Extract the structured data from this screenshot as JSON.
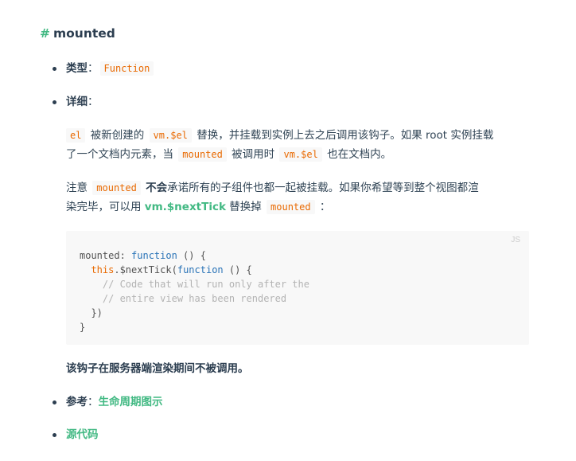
{
  "heading": {
    "hash": "#",
    "title": "mounted"
  },
  "type_item": {
    "label": "类型",
    "colon": "：",
    "value": "Function"
  },
  "detail_item": {
    "label": "详细",
    "colon": "："
  },
  "para1": {
    "code1": "el",
    "text1": "被新创建的",
    "code2": "vm.$el",
    "text2": "替换，并挂载到实例上去之后调用该钩子。如果 root 实例挂载",
    "text3": "了一个文档内元素，当",
    "code3": "mounted",
    "text4": "被调用时",
    "code4": "vm.$el",
    "text5": "也在文档内。"
  },
  "para2": {
    "text1": "注意",
    "code1": "mounted",
    "bold1": "不会",
    "text2": "承诺所有的子组件也都一起被挂载。如果你希望等到整个视图都渲",
    "text3": "染完毕，可以用",
    "link1": "vm.$nextTick",
    "text4": "替换掉",
    "code2": "mounted",
    "text5": "："
  },
  "codeblock": {
    "lang": "JS",
    "l1a": "mounted: ",
    "l1kw": "function",
    "l1b": " () {",
    "l2a": "  ",
    "l2kw": "this",
    "l2b": ".$nextTick(",
    "l2kw2": "function",
    "l2c": " () {",
    "l3": "    // Code that will run only after the",
    "l4": "    // entire view has been rendered",
    "l5": "  })",
    "l6": "}"
  },
  "note": "该钩子在服务器端渲染期间不被调用。",
  "ref_item": {
    "label": "参考",
    "colon": "：",
    "link": "生命周期图示"
  },
  "source_item": {
    "link": "源代码"
  }
}
